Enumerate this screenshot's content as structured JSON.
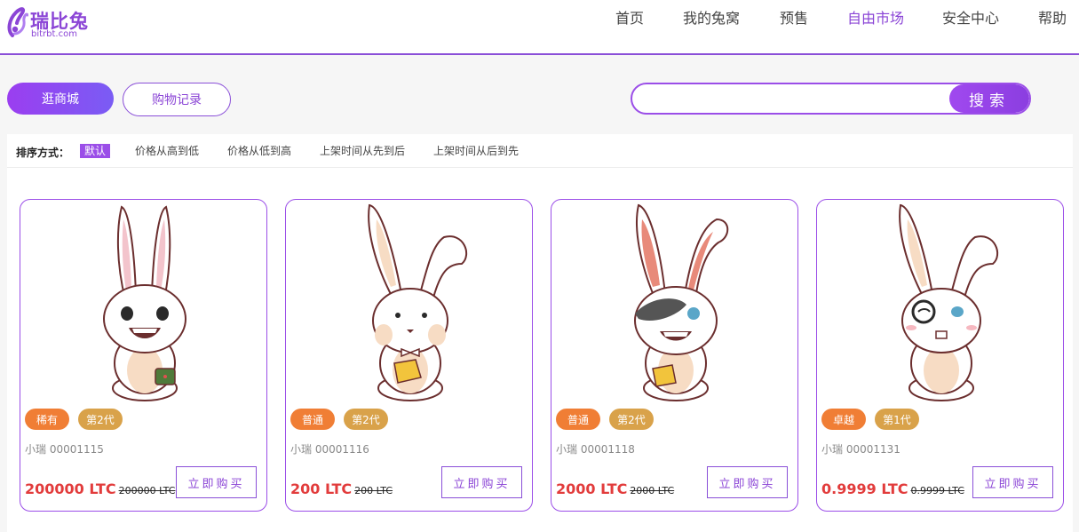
{
  "logo": {
    "name": "瑞比兔",
    "domain": "bitrbt.com"
  },
  "nav": [
    {
      "label": "首页",
      "active": false
    },
    {
      "label": "我的兔窝",
      "active": false
    },
    {
      "label": "预售",
      "active": false
    },
    {
      "label": "自由市场",
      "active": true
    },
    {
      "label": "安全中心",
      "active": false
    },
    {
      "label": "帮助",
      "active": false
    }
  ],
  "toolbar": {
    "shop_label": "逛商城",
    "history_label": "购物记录",
    "search_value": "",
    "search_button": "搜索"
  },
  "sort": {
    "label": "排序方式：",
    "options": [
      "默认",
      "价格从高到低",
      "价格从低到高",
      "上架时间从先到后",
      "上架时间从后到先"
    ],
    "selected": "默认"
  },
  "cards": [
    {
      "rarity": "稀有",
      "generation": "第2代",
      "serial": "小瑞 00001115",
      "price": "200000 LTC",
      "old_price": "200000 LTC",
      "buy_label": "立即购买"
    },
    {
      "rarity": "普通",
      "generation": "第2代",
      "serial": "小瑞 00001116",
      "price": "200 LTC",
      "old_price": "200 LTC",
      "buy_label": "立即购买"
    },
    {
      "rarity": "普通",
      "generation": "第2代",
      "serial": "小瑞 00001118",
      "price": "2000 LTC",
      "old_price": "2000 LTC",
      "buy_label": "立即购买"
    },
    {
      "rarity": "卓越",
      "generation": "第1代",
      "serial": "小瑞 00001131",
      "price": "0.9999 LTC",
      "old_price": "0.9999 LTC",
      "buy_label": "立即购买"
    }
  ],
  "colors": {
    "accent": "#8b45d6",
    "price": "#e23c3c",
    "rarity_tag": "#f07e35",
    "generation_tag": "#d9a24a"
  }
}
